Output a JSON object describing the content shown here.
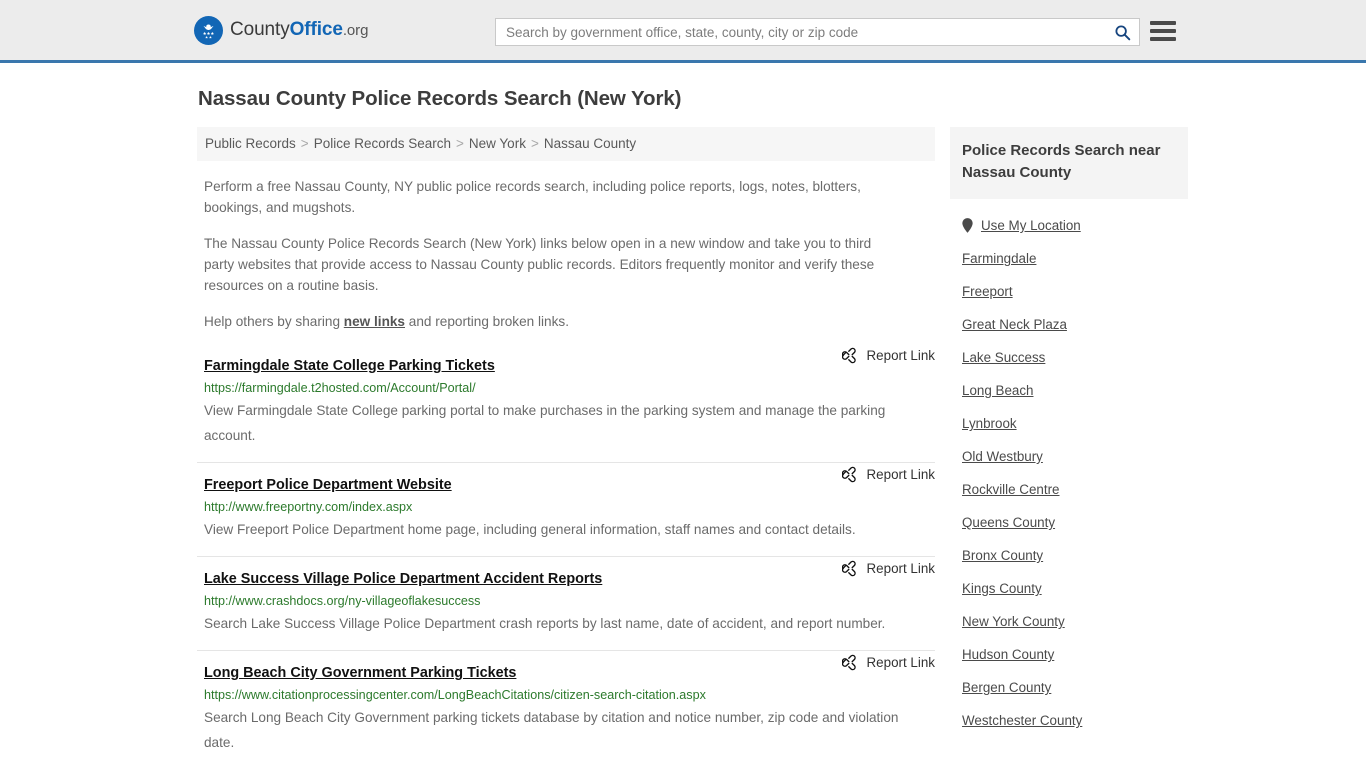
{
  "header": {
    "brand": {
      "part1": "County",
      "part2": "Office",
      "part3": ".org",
      "logo_icon": "eagle-stars-emblem-icon"
    },
    "search": {
      "placeholder": "Search by government office, state, county, city or zip code",
      "value": "",
      "icon": "search-icon"
    },
    "menu_icon": "hamburger-menu-icon"
  },
  "page": {
    "title": "Nassau County Police Records Search (New York)"
  },
  "breadcrumb": {
    "items": [
      {
        "label": "Public Records"
      },
      {
        "label": "Police Records Search"
      },
      {
        "label": "New York"
      },
      {
        "label": "Nassau County"
      }
    ],
    "separator": ">"
  },
  "intro": {
    "p1": "Perform a free Nassau County, NY public police records search, including police reports, logs, notes, blotters, bookings, and mugshots.",
    "p2": "The Nassau County Police Records Search (New York) links below open in a new window and take you to third party websites that provide access to Nassau County public records. Editors frequently monitor and verify these resources on a routine basis.",
    "p3_before": "Help others by sharing ",
    "p3_link": "new links",
    "p3_after": " and reporting broken links."
  },
  "results": {
    "report_label": "Report Link",
    "report_icon": "broken-link-icon",
    "items": [
      {
        "title": "Farmingdale State College Parking Tickets",
        "url": "https://farmingdale.t2hosted.com/Account/Portal/",
        "description": "View Farmingdale State College parking portal to make purchases in the parking system and manage the parking account."
      },
      {
        "title": "Freeport Police Department Website",
        "url": "http://www.freeportny.com/index.aspx",
        "description": "View Freeport Police Department home page, including general information, staff names and contact details."
      },
      {
        "title": "Lake Success Village Police Department Accident Reports",
        "url": "http://www.crashdocs.org/ny-villageoflakesuccess",
        "description": "Search Lake Success Village Police Department crash reports by last name, date of accident, and report number."
      },
      {
        "title": "Long Beach City Government Parking Tickets",
        "url": "https://www.citationprocessingcenter.com/LongBeachCitations/citizen-search-citation.aspx",
        "description": "Search Long Beach City Government parking tickets database by citation and notice number, zip code and violation date."
      }
    ]
  },
  "sidebar": {
    "heading": "Police Records Search near Nassau County",
    "use_my_location": {
      "label": "Use My Location",
      "icon": "map-pin-icon"
    },
    "items": [
      {
        "label": "Farmingdale"
      },
      {
        "label": "Freeport"
      },
      {
        "label": "Great Neck Plaza"
      },
      {
        "label": "Lake Success"
      },
      {
        "label": "Long Beach"
      },
      {
        "label": "Lynbrook"
      },
      {
        "label": "Old Westbury"
      },
      {
        "label": "Rockville Centre"
      },
      {
        "label": "Queens County"
      },
      {
        "label": "Bronx County"
      },
      {
        "label": "Kings County"
      },
      {
        "label": "New York County"
      },
      {
        "label": "Hudson County"
      },
      {
        "label": "Bergen County"
      },
      {
        "label": "Westchester County"
      }
    ]
  },
  "colors": {
    "brand_blue": "#1266b5",
    "header_bg": "#ececec",
    "header_rule": "#3a77ad",
    "url_green": "#2c7a2c",
    "breadcrumb_bg": "#f6f6f6"
  }
}
